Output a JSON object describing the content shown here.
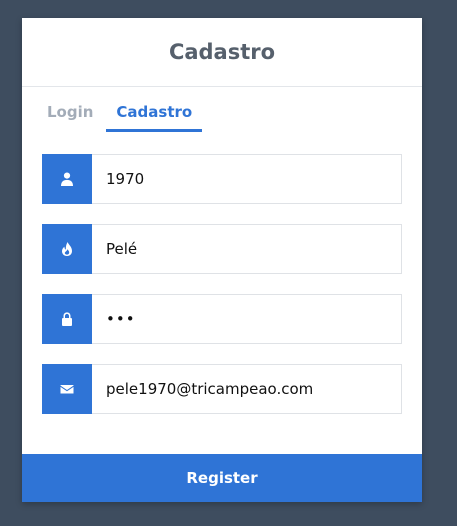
{
  "header": {
    "title": "Cadastro"
  },
  "tabs": [
    {
      "label": "Login",
      "active": false
    },
    {
      "label": "Cadastro",
      "active": true
    }
  ],
  "form": {
    "fields": [
      {
        "icon": "user-icon",
        "type": "text",
        "value": "1970"
      },
      {
        "icon": "fire-icon",
        "type": "text",
        "value": "Pelé"
      },
      {
        "icon": "lock-icon",
        "type": "password",
        "value": "123"
      },
      {
        "icon": "envelope-icon",
        "type": "email",
        "value": "pele1970@tricampeao.com"
      }
    ],
    "submit_label": "Register"
  },
  "colors": {
    "accent": "#2f74d6",
    "background": "#3e4d5f",
    "title": "#56606c",
    "tab_inactive": "#a3acb8"
  }
}
